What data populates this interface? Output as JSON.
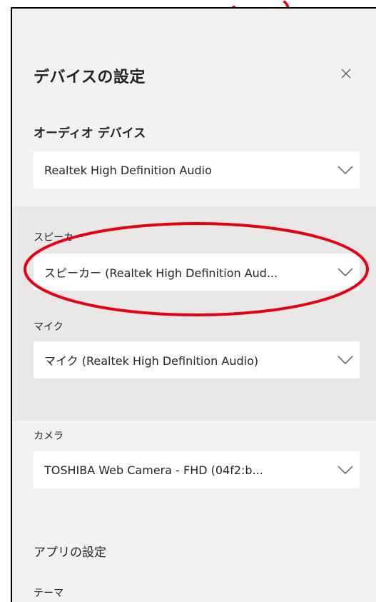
{
  "panel": {
    "title": "デバイスの設定",
    "close_icon": "close-icon"
  },
  "audio": {
    "heading": "オーディオ デバイス",
    "device_value": "Realtek High Definition Audio"
  },
  "speaker": {
    "label": "スピーカー",
    "value": "スピーカー (Realtek High Definition Aud..."
  },
  "mic": {
    "label": "マイク",
    "value": "マイク (Realtek High Definition Audio)"
  },
  "camera": {
    "label": "カメラ",
    "value": "TOSHIBA Web Camera - FHD (04f2:b..."
  },
  "app_settings": {
    "heading": "アプリの設定",
    "theme_label": "テーマ"
  },
  "colors": {
    "annotation": "#e60012",
    "panel_bg": "#f3f2f1",
    "shaded_bg": "#e9e8e7"
  }
}
